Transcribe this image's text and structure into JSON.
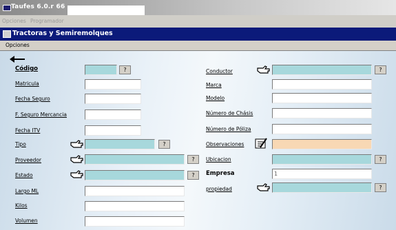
{
  "app": {
    "title": "Taufes 6.0.r 66",
    "menu": [
      "Opciones",
      "Programador"
    ]
  },
  "window": {
    "title": "Tractoras y Semiremolques",
    "menu_label": "Opciones"
  },
  "left_fields": [
    {
      "label": "Código",
      "value": ""
    },
    {
      "label": "Matricula",
      "value": ""
    },
    {
      "label": "Fecha Seguro",
      "value": ""
    },
    {
      "label": "F. Seguro Mercancia",
      "value": ""
    },
    {
      "label": "Fecha ITV",
      "value": ""
    },
    {
      "label": "Tipo",
      "value": ""
    },
    {
      "label": "Proveedor",
      "value": ""
    },
    {
      "label": "Estado",
      "value": ""
    },
    {
      "label": "Largo ML",
      "value": ""
    },
    {
      "label": "Kilos",
      "value": ""
    },
    {
      "label": "Volumen",
      "value": ""
    }
  ],
  "right_fields": [
    {
      "label": "Conductor",
      "value": ""
    },
    {
      "label": "Marca",
      "value": ""
    },
    {
      "label": "Modelo",
      "value": ""
    },
    {
      "label": "Número de Chásis",
      "value": ""
    },
    {
      "label": "Número de Póliza",
      "value": ""
    },
    {
      "label": "Observaciones",
      "value": ""
    },
    {
      "label": "Ubicacion",
      "value": ""
    },
    {
      "label": "Empresa",
      "value": "1"
    },
    {
      "label": "propiedad",
      "value": ""
    }
  ],
  "lookup_button_label": "?",
  "colors": {
    "titlebar": "#0b1a7a",
    "lookup_field": "#a7d8dc",
    "memo_field": "#f8d8b4"
  }
}
